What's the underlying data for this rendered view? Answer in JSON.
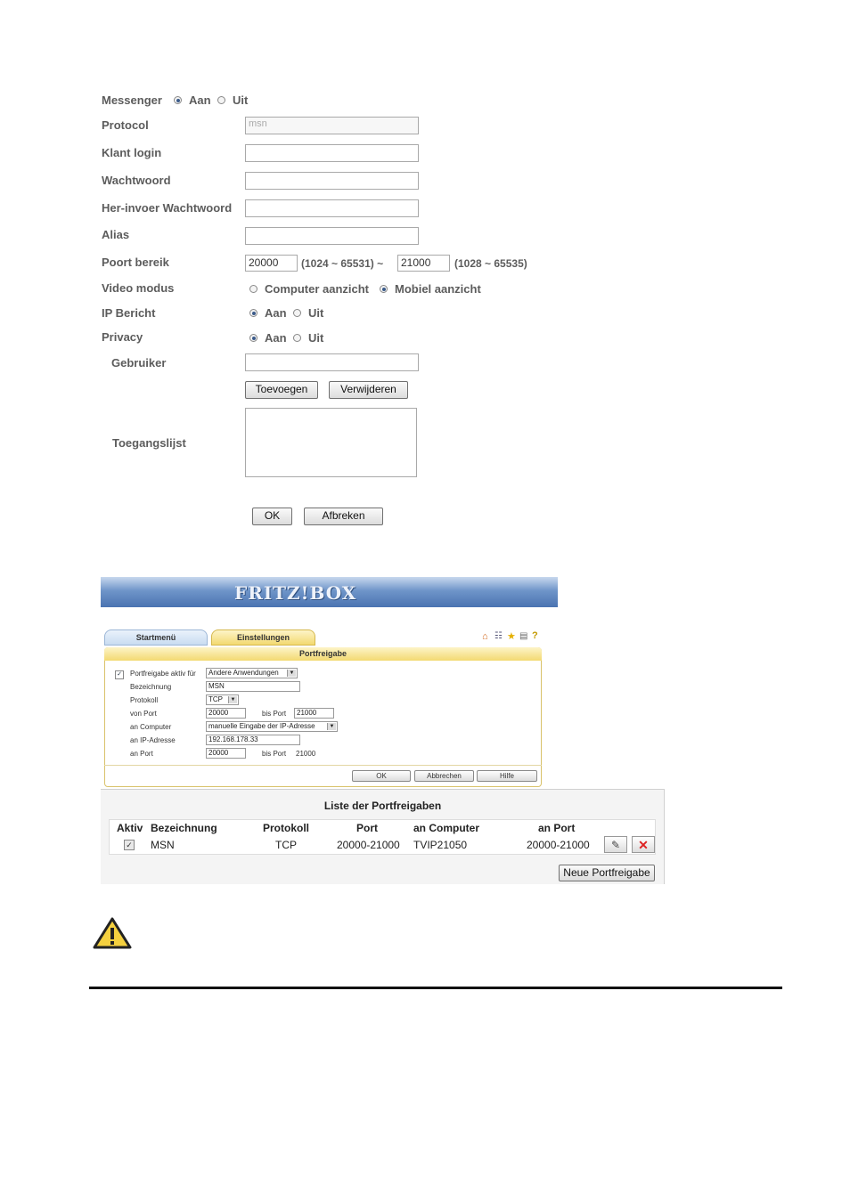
{
  "messenger": {
    "label": "Messenger",
    "opt_on": "Aan",
    "opt_off": "Uit"
  },
  "form": {
    "protocol_label": "Protocol",
    "protocol_value": "msn",
    "klant_login_label": "Klant login",
    "wachtwoord_label": "Wachtwoord",
    "her_invoer_label": "Her-invoer Wachtwoord",
    "alias_label": "Alias",
    "poort_label": "Poort bereik",
    "poort_start": "20000",
    "poort_start_range": "(1024 ~ 65531) ~",
    "poort_end": "21000",
    "poort_end_range": "(1028 ~ 65535)",
    "video_label": "Video modus",
    "video_opt1": "Computer aanzicht",
    "video_opt2": "Mobiel aanzicht",
    "ip_label": "IP Bericht",
    "ip_on": "Aan",
    "ip_off": "Uit",
    "privacy_label": "Privacy",
    "privacy_on": "Aan",
    "privacy_off": "Uit",
    "gebruiker_label": "Gebruiker",
    "toevoegen": "Toevoegen",
    "verwijderen": "Verwijderen",
    "toegangslijst_label": "Toegangslijst",
    "ok": "OK",
    "afbreken": "Afbreken"
  },
  "fritzbox": {
    "logo": "FRITZ!BOX",
    "tab_start": "Startmenü",
    "tab_settings": "Einstellungen",
    "panel_title": "Portfreigabe",
    "aktiv_label": "Portfreigabe aktiv für",
    "aktiv_value": "Andere Anwendungen",
    "bezeichnung_label": "Bezeichnung",
    "bezeichnung_value": "MSN",
    "protokoll_label": "Protokoll",
    "protokoll_value": "TCP",
    "von_port_label": "von Port",
    "von_port_value": "20000",
    "bis_port_label": "bis Port",
    "bis_port_value": "21000",
    "an_computer_label": "an Computer",
    "an_computer_value": "manuelle Eingabe der IP-Adresse",
    "an_ip_label": "an IP-Adresse",
    "an_ip_value": "192.168.178.33",
    "an_port_label": "an Port",
    "an_port_value": "20000",
    "an_bis_port_label": "bis Port",
    "an_bis_port_value": "21000",
    "btn_ok": "OK",
    "btn_abbrechen": "Abbrechen",
    "btn_hilfe": "Hilfe"
  },
  "liste": {
    "title": "Liste der Portfreigaben",
    "headers": [
      "Aktiv",
      "Bezeichnung",
      "Protokoll",
      "Port",
      "an Computer",
      "an Port"
    ],
    "row": {
      "bezeichnung": "MSN",
      "protokoll": "TCP",
      "port": "20000-21000",
      "computer": "TVIP21050",
      "an_port": "20000-21000"
    },
    "neue": "Neue Portfreigabe"
  },
  "icons": [
    "radio-icon",
    "checkbox-icon",
    "home-icon",
    "tree-icon",
    "star-icon",
    "print-icon",
    "help-icon",
    "edit-icon",
    "delete-icon",
    "warning-icon"
  ]
}
